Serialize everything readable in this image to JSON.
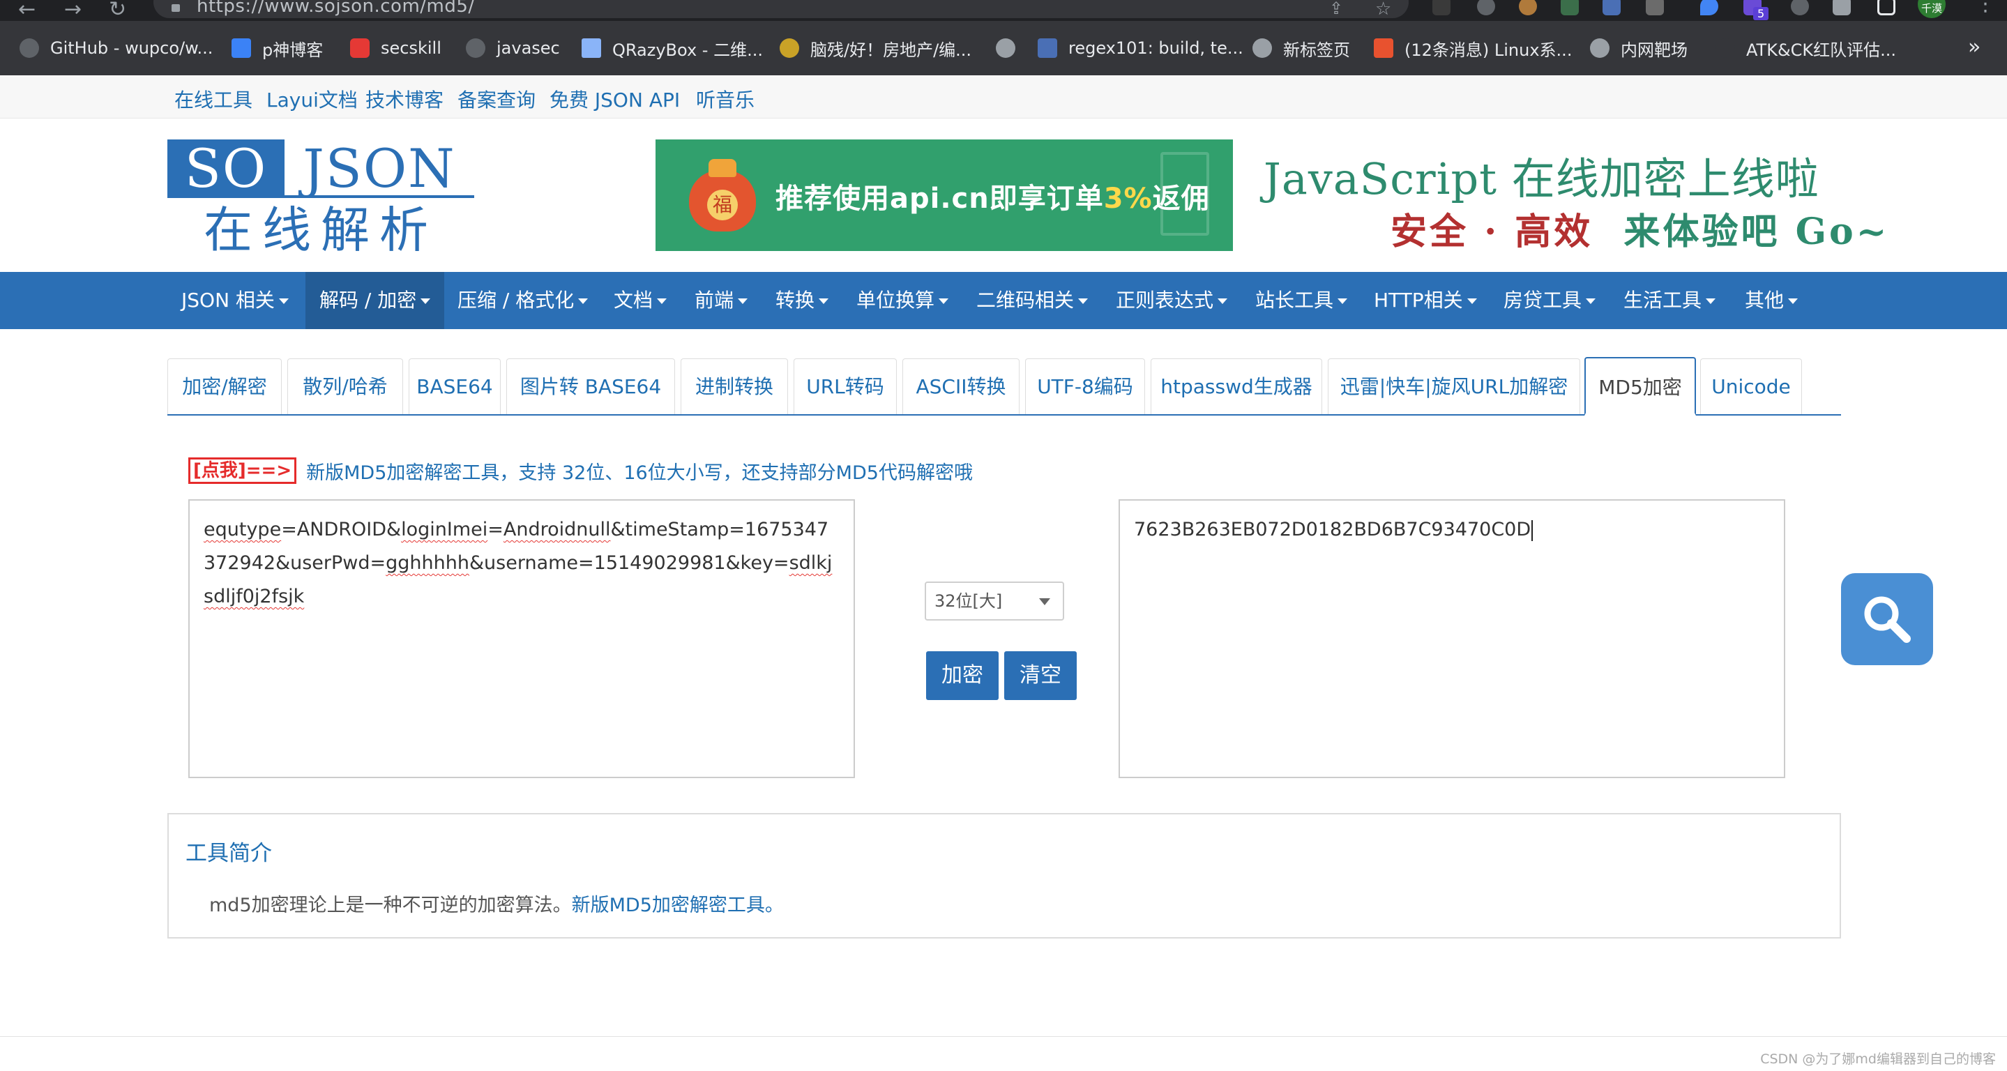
{
  "browser": {
    "url": "https://www.sojson.com/md5/",
    "profile_badge": "千漠",
    "extension_count": "5",
    "bookmarks": [
      {
        "label": "GitHub - wupco/w...",
        "icon": "github-icon",
        "color": "#5f6368"
      },
      {
        "label": "p神博客",
        "icon": "grid-icon",
        "color": "#3b82f6"
      },
      {
        "label": "secskill",
        "icon": "chat-icon",
        "color": "#e53935"
      },
      {
        "label": "javasec",
        "icon": "github-icon",
        "color": "#5f6368"
      },
      {
        "label": "QRazyBox - 二维...",
        "icon": "qr-icon",
        "color": "#8ab4f8"
      },
      {
        "label": "脑残/好！房地产/编...",
        "icon": "brain-icon",
        "color": "#c9a227"
      },
      {
        "label": "",
        "icon": "globe-icon",
        "color": "#9aa0a6"
      },
      {
        "label": "regex101: build, te...",
        "icon": "regex-icon",
        "color": "#4a6fb5"
      },
      {
        "label": "新标签页",
        "icon": "globe-icon",
        "color": "#9aa0a6"
      },
      {
        "label": "(12条消息) Linux系...",
        "icon": "csdn-icon",
        "color": "#e8522f"
      },
      {
        "label": "内网靶场",
        "icon": "globe-icon",
        "color": "#9aa0a6"
      },
      {
        "label": "ATK&CK红队评估...",
        "icon": "blank-icon",
        "color": "#35363a"
      }
    ],
    "more_glyph": "»"
  },
  "topbar": {
    "links": [
      "在线工具",
      "Layui文档",
      "技术博客",
      "备案查询",
      "免费 JSON API",
      "听音乐"
    ]
  },
  "header": {
    "logo_so": "SO",
    "logo_json": "JSON",
    "logo_cn": "在线解析",
    "banner_char": "福",
    "banner_text_a": "推荐使用api.cn即享订单",
    "banner_pct": "3%",
    "banner_text_b": "返佣",
    "promo_line1": "JavaScript 在线加密上线啦",
    "promo_line2_a": "安全 · 高效",
    "promo_line2_b": "来体验吧 Go~"
  },
  "mainnav": {
    "items": [
      "JSON 相关",
      "解码 / 加密",
      "压缩 / 格式化",
      "文档",
      "前端",
      "转换",
      "单位换算",
      "二维码相关",
      "正则表达式",
      "站长工具",
      "HTTP相关",
      "房贷工具",
      "生活工具",
      "其他"
    ],
    "active_index": 1
  },
  "tabs": {
    "items": [
      "加密/解密",
      "散列/哈希",
      "BASE64",
      "图片转 BASE64",
      "进制转换",
      "URL转码",
      "ASCII转换",
      "UTF-8编码",
      "htpasswd生成器",
      "迅雷|快车|旋风URL加解密",
      "MD5加密",
      "Unicode"
    ],
    "active_index": 10
  },
  "notice": {
    "click_label": "[点我]==>",
    "text": "新版MD5加密解密工具，支持 32位、16位大小写，还支持部分MD5代码解密哦"
  },
  "tool": {
    "input_parts": {
      "p1": "equtype",
      "p2": "=ANDROID&",
      "p3": "loginImei",
      "p4": "=",
      "p5": "Androidnull",
      "p6": "&timeStamp=1675347372942&userPwd=",
      "p7": "gghhhhh",
      "p8": "&username=15149029981&key=",
      "p9": "sdlkjsdljf0j2fsjk"
    },
    "output_value": "7623B263EB072D0182BD6B7C93470C0D",
    "mode_selected": "32位[大]",
    "encrypt_label": "加密",
    "clear_label": "清空"
  },
  "intro": {
    "title": "工具简介",
    "body_text": "md5加密理论上是一种不可逆的加密算法。",
    "body_link": "新版MD5加密解密工具。"
  },
  "footer": {
    "watermark": "CSDN @为了娜md编辑器到自己的博客"
  },
  "colors": {
    "brand_blue": "#2b6fb5",
    "link_blue": "#1f6fb2",
    "banner_green": "#31a06d",
    "alert_red": "#e52b2b"
  }
}
